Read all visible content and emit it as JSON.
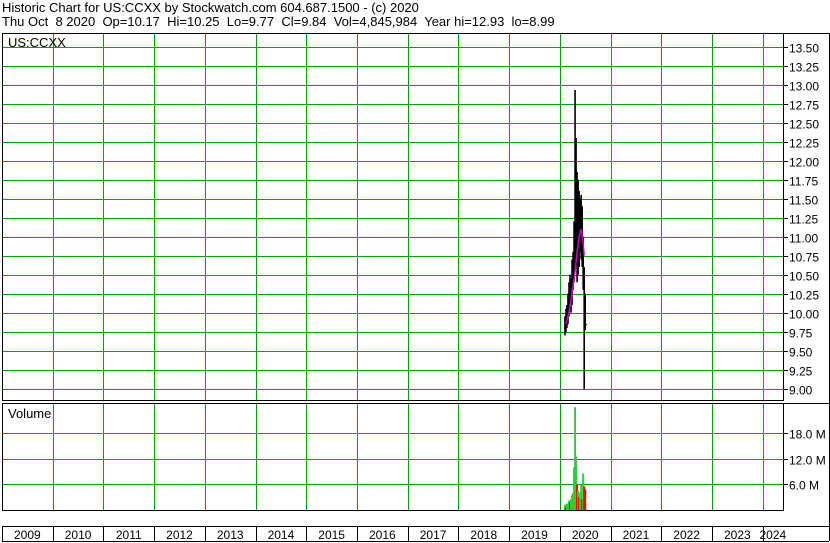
{
  "header": {
    "line1": "Historic Chart for US:CCXX by Stockwatch.com 604.687.1500 - (c) 2020",
    "line2": "Thu Oct  8 2020  Op=10.17  Hi=10.25  Lo=9.77  Cl=9.84  Vol=4,845,984  Year hi=12.93  lo=8.99"
  },
  "colors": {
    "grid": "#00a000",
    "price_bar": "#000000",
    "moving_average": "#cc00cc",
    "volume_up": "#33cc33",
    "volume_down": "#ff0000",
    "frame": "#000000"
  },
  "chart_data": [
    {
      "type": "line",
      "title": "US:CCXX",
      "description_label": "US:CCXX",
      "x_axis": {
        "ticks": [
          "2009",
          "2010",
          "2011",
          "2012",
          "2013",
          "2014",
          "2015",
          "2016",
          "2017",
          "2018",
          "2019",
          "2020",
          "2021",
          "2022",
          "2023",
          "2024"
        ],
        "range": [
          2009,
          2024.4
        ]
      },
      "y_axis": {
        "ticks": [
          "13.50",
          "13.25",
          "13.00",
          "12.75",
          "12.50",
          "12.25",
          "12.00",
          "11.75",
          "11.50",
          "11.25",
          "11.00",
          "10.75",
          "10.50",
          "10.25",
          "10.00",
          "9.75",
          "9.50",
          "9.25",
          "9.00"
        ],
        "range": [
          8.85,
          13.68
        ],
        "position": "right"
      },
      "grid": true,
      "series": [
        {
          "kind": "hlc",
          "points": [
            {
              "x": 2020.1,
              "h": 9.95,
              "l": 9.7,
              "c": 9.8
            },
            {
              "x": 2020.12,
              "h": 10.05,
              "l": 9.74,
              "c": 9.9
            },
            {
              "x": 2020.14,
              "h": 10.1,
              "l": 9.8,
              "c": 9.95
            },
            {
              "x": 2020.16,
              "h": 10.25,
              "l": 9.85,
              "c": 10.1
            },
            {
              "x": 2020.18,
              "h": 10.4,
              "l": 9.95,
              "c": 10.2
            },
            {
              "x": 2020.2,
              "h": 10.5,
              "l": 10.05,
              "c": 10.3
            },
            {
              "x": 2020.22,
              "h": 10.45,
              "l": 10.0,
              "c": 10.25
            },
            {
              "x": 2020.24,
              "h": 10.7,
              "l": 10.1,
              "c": 10.4
            },
            {
              "x": 2020.26,
              "h": 10.8,
              "l": 10.3,
              "c": 10.6
            },
            {
              "x": 2020.28,
              "h": 11.2,
              "l": 10.4,
              "c": 10.9
            },
            {
              "x": 2020.3,
              "h": 12.93,
              "l": 10.6,
              "c": 11.2
            },
            {
              "x": 2020.32,
              "h": 12.3,
              "l": 10.7,
              "c": 11.6
            },
            {
              "x": 2020.34,
              "h": 11.85,
              "l": 10.4,
              "c": 11.3
            },
            {
              "x": 2020.36,
              "h": 11.75,
              "l": 10.5,
              "c": 11.1
            },
            {
              "x": 2020.38,
              "h": 11.6,
              "l": 10.6,
              "c": 11.0
            },
            {
              "x": 2020.4,
              "h": 11.5,
              "l": 10.8,
              "c": 11.2
            },
            {
              "x": 2020.42,
              "h": 11.55,
              "l": 10.7,
              "c": 11.0
            },
            {
              "x": 2020.44,
              "h": 11.4,
              "l": 10.6,
              "c": 10.8
            },
            {
              "x": 2020.46,
              "h": 11.0,
              "l": 10.3,
              "c": 10.5
            },
            {
              "x": 2020.48,
              "h": 10.6,
              "l": 8.99,
              "c": 10.0
            },
            {
              "x": 2020.5,
              "h": 10.25,
              "l": 9.77,
              "c": 9.84
            }
          ]
        },
        {
          "kind": "moving_average",
          "points": [
            {
              "x": 2020.12,
              "y": 9.85
            },
            {
              "x": 2020.18,
              "y": 10.0
            },
            {
              "x": 2020.24,
              "y": 10.25
            },
            {
              "x": 2020.3,
              "y": 10.55
            },
            {
              "x": 2020.34,
              "y": 10.8
            },
            {
              "x": 2020.38,
              "y": 11.0
            },
            {
              "x": 2020.42,
              "y": 11.1
            },
            {
              "x": 2020.46,
              "y": 10.9
            },
            {
              "x": 2020.48,
              "y": 10.75
            }
          ]
        }
      ]
    },
    {
      "type": "bar",
      "title": "Volume",
      "description_label": "Volume",
      "y_axis": {
        "ticks": [
          "18.0 M",
          "12.0 M",
          "6.0 M"
        ],
        "range": [
          0,
          25
        ],
        "unit": "M",
        "position": "right"
      },
      "series": [
        {
          "kind": "volume",
          "bars": [
            {
              "x": 2020.1,
              "v": 1.2,
              "dir": "up"
            },
            {
              "x": 2020.12,
              "v": 0.8,
              "dir": "down"
            },
            {
              "x": 2020.14,
              "v": 1.5,
              "dir": "up"
            },
            {
              "x": 2020.16,
              "v": 1.0,
              "dir": "up"
            },
            {
              "x": 2020.18,
              "v": 2.2,
              "dir": "up"
            },
            {
              "x": 2020.2,
              "v": 1.8,
              "dir": "down"
            },
            {
              "x": 2020.22,
              "v": 2.5,
              "dir": "up"
            },
            {
              "x": 2020.24,
              "v": 3.5,
              "dir": "up"
            },
            {
              "x": 2020.26,
              "v": 4.0,
              "dir": "up"
            },
            {
              "x": 2020.28,
              "v": 10.0,
              "dir": "up"
            },
            {
              "x": 2020.3,
              "v": 24.0,
              "dir": "up"
            },
            {
              "x": 2020.32,
              "v": 12.5,
              "dir": "up"
            },
            {
              "x": 2020.34,
              "v": 6.0,
              "dir": "down"
            },
            {
              "x": 2020.36,
              "v": 4.5,
              "dir": "up"
            },
            {
              "x": 2020.38,
              "v": 3.0,
              "dir": "down"
            },
            {
              "x": 2020.4,
              "v": 4.0,
              "dir": "up"
            },
            {
              "x": 2020.42,
              "v": 6.0,
              "dir": "up"
            },
            {
              "x": 2020.44,
              "v": 2.5,
              "dir": "down"
            },
            {
              "x": 2020.46,
              "v": 8.5,
              "dir": "up"
            },
            {
              "x": 2020.48,
              "v": 5.5,
              "dir": "down"
            },
            {
              "x": 2020.5,
              "v": 4.8,
              "dir": "down"
            }
          ]
        }
      ]
    }
  ]
}
